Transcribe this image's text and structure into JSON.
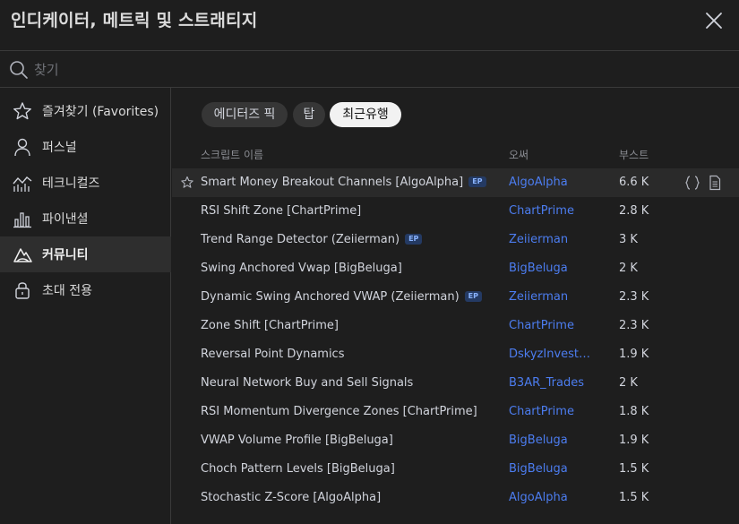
{
  "dialog": {
    "title": "인디케이터, 메트릭 및 스트래티지"
  },
  "search": {
    "placeholder": "찾기",
    "value": ""
  },
  "sidebar": {
    "items": [
      {
        "label": "즐겨찾기 (Favorites)",
        "icon": "star-icon"
      },
      {
        "label": "퍼스널",
        "icon": "user-icon"
      },
      {
        "label": "테크니컬즈",
        "icon": "technicals-chart-icon"
      },
      {
        "label": "파이낸셜",
        "icon": "bar-chart-icon"
      },
      {
        "label": "커뮤니티",
        "icon": "community-icon",
        "active": true
      },
      {
        "label": "초대 전용",
        "icon": "lock-icon"
      }
    ]
  },
  "tabs": [
    {
      "label": "에디터즈 픽"
    },
    {
      "label": "탑"
    },
    {
      "label": "최근유행",
      "active": true
    }
  ],
  "table": {
    "headers": {
      "name": "스크립트 이름",
      "author": "오써",
      "boost": "부스트"
    },
    "rows": [
      {
        "name": "Smart Money Breakout Channels [AlgoAlpha]",
        "badge": "EP",
        "author": "AlgoAlpha",
        "boost": "6.6 K"
      },
      {
        "name": "RSI Shift Zone [ChartPrime]",
        "author": "ChartPrime",
        "boost": "2.8 K"
      },
      {
        "name": "Trend Range Detector (Zeiierman)",
        "badge": "EP",
        "author": "Zeiierman",
        "boost": "3 K"
      },
      {
        "name": "Swing Anchored Vwap [BigBeluga]",
        "author": "BigBeluga",
        "boost": "2 K"
      },
      {
        "name": "Dynamic Swing Anchored VWAP (Zeiierman)",
        "badge": "EP",
        "author": "Zeiierman",
        "boost": "2.3 K"
      },
      {
        "name": "Zone Shift [ChartPrime]",
        "author": "ChartPrime",
        "boost": "2.3 K"
      },
      {
        "name": "Reversal Point Dynamics",
        "author": "DskyzInvestm…",
        "boost": "1.9 K"
      },
      {
        "name": "Neural Network Buy and Sell Signals",
        "author": "B3AR_Trades",
        "boost": "2 K"
      },
      {
        "name": "RSI Momentum Divergence Zones [ChartPrime]",
        "author": "ChartPrime",
        "boost": "1.8 K"
      },
      {
        "name": "VWAP Volume Profile [BigBeluga]",
        "author": "BigBeluga",
        "boost": "1.9 K"
      },
      {
        "name": "Choch Pattern Levels [BigBeluga]",
        "author": "BigBeluga",
        "boost": "1.5 K"
      },
      {
        "name": "Stochastic Z-Score [AlgoAlpha]",
        "author": "AlgoAlpha",
        "boost": "1.5 K"
      }
    ]
  },
  "colors": {
    "background": "#1e1e1e",
    "author_link": "#4c7df0",
    "active_tab_bg": "#f2f2f2",
    "ep_badge_bg": "#243a63"
  }
}
